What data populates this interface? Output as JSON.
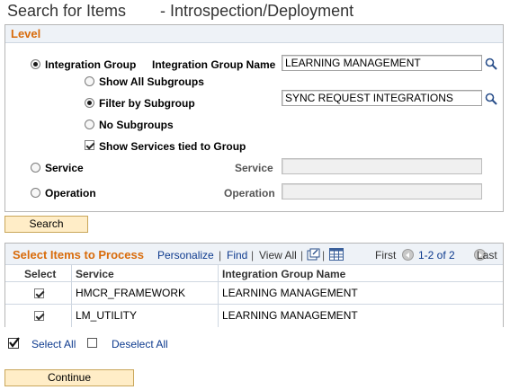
{
  "page": {
    "title": "Search for Items",
    "subtitle": "- Introspection/Deployment"
  },
  "level": {
    "header": "Level",
    "integration_group_radio": "Integration Group",
    "integration_group_name_label": "Integration Group Name",
    "integration_group_name_value": "LEARNING MANAGEMENT",
    "show_all_subgroups": "Show All Subgroups",
    "filter_by_subgroup": "Filter by Subgroup",
    "subgroup_value": "SYNC REQUEST INTEGRATIONS",
    "no_subgroups": "No Subgroups",
    "show_services_tied": "Show Services tied to Group",
    "service_radio": "Service",
    "service_label": "Service",
    "service_value": "",
    "operation_radio": "Operation",
    "operation_label": "Operation",
    "operation_value": ""
  },
  "search_button": "Search",
  "grid": {
    "title": "Select Items to Process",
    "personalize": "Personalize",
    "find": "Find",
    "view_all": "View All",
    "first": "First",
    "range": "1-2 of 2",
    "last": "Last",
    "columns": [
      "Select",
      "Service",
      "Integration Group Name"
    ],
    "rows": [
      {
        "service": "HMCR_FRAMEWORK",
        "group": "LEARNING MANAGEMENT",
        "selected": true
      },
      {
        "service": "LM_UTILITY",
        "group": "LEARNING MANAGEMENT",
        "selected": true
      }
    ]
  },
  "select_all": "Select All",
  "deselect_all": "Deselect All",
  "continue_button": "Continue",
  "colors": {
    "section_header_text": "#d86b0b",
    "link": "#0d3a8e",
    "button_bg": "#ffedc7"
  }
}
